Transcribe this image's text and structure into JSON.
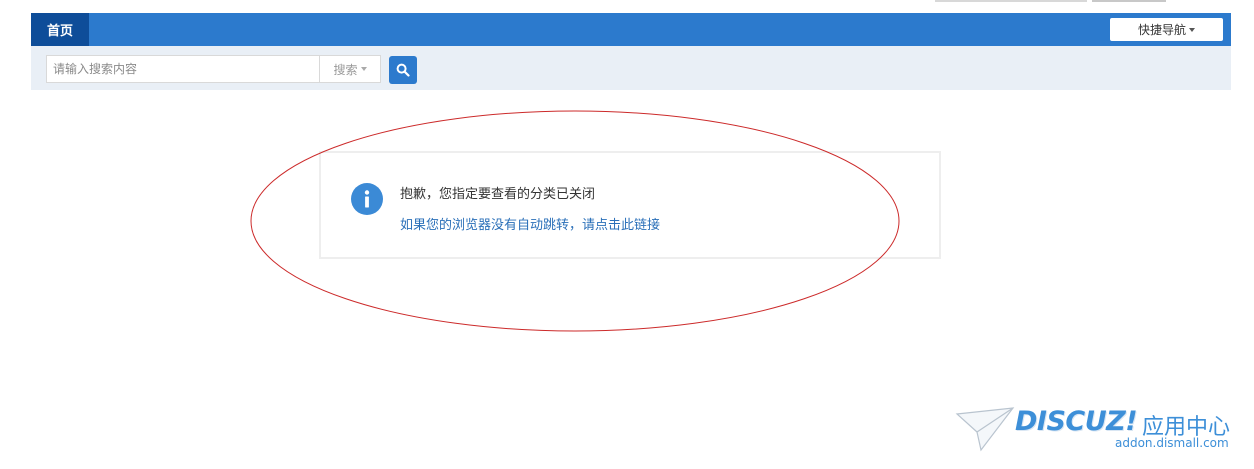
{
  "navbar": {
    "home_label": "首页",
    "quick_nav_label": "快捷导航"
  },
  "search": {
    "placeholder": "请输入搜索内容",
    "type_label": "搜索"
  },
  "message": {
    "text": "抱歉，您指定要查看的分类已关闭",
    "link_text": "如果您的浏览器没有自动跳转，请点击此链接"
  },
  "watermark": {
    "brand": "DISCUZ!",
    "cn": "应用中心",
    "url": "addon.dismall.com"
  },
  "colors": {
    "navbar": "#2c7acd",
    "nav_home_active": "#0e4d99",
    "search_area": "#e9eff6",
    "info_icon": "#3b8ad6",
    "link": "#2a6fb8",
    "annotation_ellipse": "#cc2a2a"
  }
}
